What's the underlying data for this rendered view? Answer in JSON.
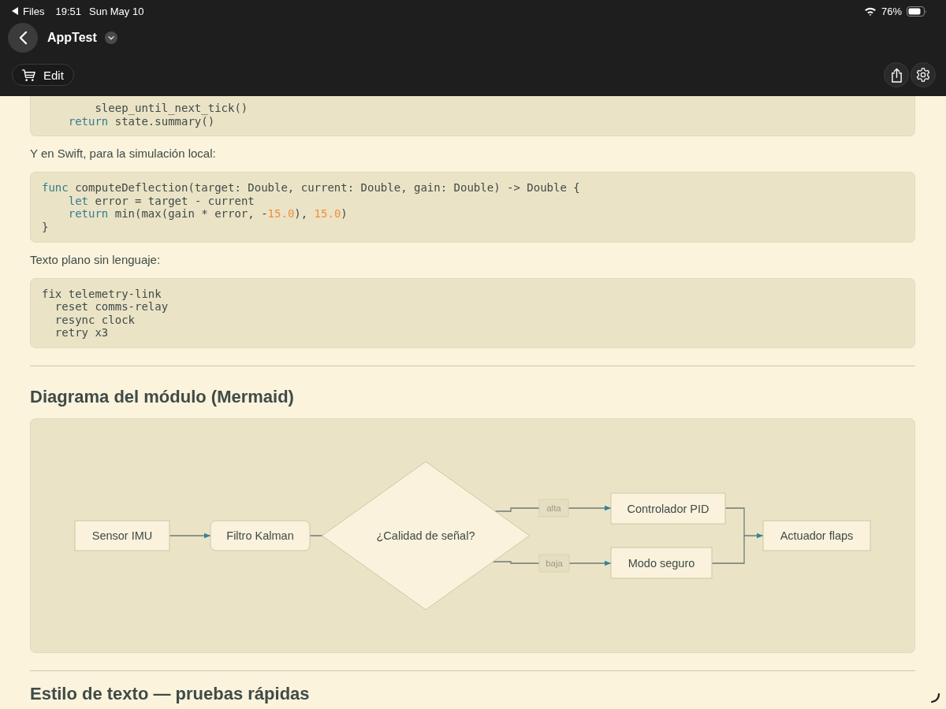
{
  "status_bar": {
    "back_app": "Files",
    "time": "19:51",
    "date": "Sun May 10",
    "battery": "76%"
  },
  "toolbar": {
    "title": "AppTest",
    "edit_button": "Edit"
  },
  "content": [
    {
      "kind": "code",
      "lines": [
        [
          {
            "text": "        sleep_until_next_tick()"
          }
        ],
        [
          {
            "text": "    return",
            "kind": "keyword"
          },
          {
            "text": " state.summary()"
          }
        ]
      ]
    },
    {
      "kind": "paragraph",
      "text": "Y en Swift, para la simulación local:"
    },
    {
      "kind": "code",
      "lines": [
        [
          {
            "text": "func",
            "kind": "keyword"
          },
          {
            "text": " computeDeflection(target: Double, current: Double, gain: Double) -> Double {"
          }
        ],
        [
          {
            "text": "    let",
            "kind": "keyword"
          },
          {
            "text": " error = target - current"
          }
        ],
        [
          {
            "text": "    return",
            "kind": "keyword"
          },
          {
            "text": " min(max(gain * error, -"
          },
          {
            "text": "15.0",
            "kind": "number"
          },
          {
            "text": "), "
          },
          {
            "text": "15.0",
            "kind": "number"
          },
          {
            "text": ")"
          }
        ],
        [
          {
            "text": "}"
          }
        ]
      ]
    },
    {
      "kind": "paragraph",
      "text": "Texto plano sin lenguaje:"
    },
    {
      "kind": "code",
      "lines": [
        [
          {
            "text": "fix telemetry-link"
          }
        ],
        [
          {
            "text": "  reset comms-relay"
          }
        ],
        [
          {
            "text": "  resync clock"
          }
        ],
        [
          {
            "text": "  retry x3"
          }
        ]
      ]
    },
    {
      "kind": "divider"
    },
    {
      "kind": "heading",
      "text": "Diagrama del módulo (Mermaid)"
    },
    {
      "kind": "diagram",
      "nodes": [
        {
          "label": "Sensor IMU",
          "kind": "rect"
        },
        {
          "label": "Filtro Kalman",
          "kind": "round"
        },
        {
          "label": "¿Calidad de señal?",
          "kind": "diamond"
        },
        {
          "label": "Controlador PID",
          "kind": "rect"
        },
        {
          "label": "Modo seguro",
          "kind": "rect"
        },
        {
          "label": "Actuador flaps",
          "kind": "rect"
        }
      ],
      "edge_labels": [
        "alta",
        "baja"
      ]
    },
    {
      "kind": "divider"
    },
    {
      "kind": "heading",
      "text": "Estilo de texto — pruebas rápidas"
    }
  ]
}
